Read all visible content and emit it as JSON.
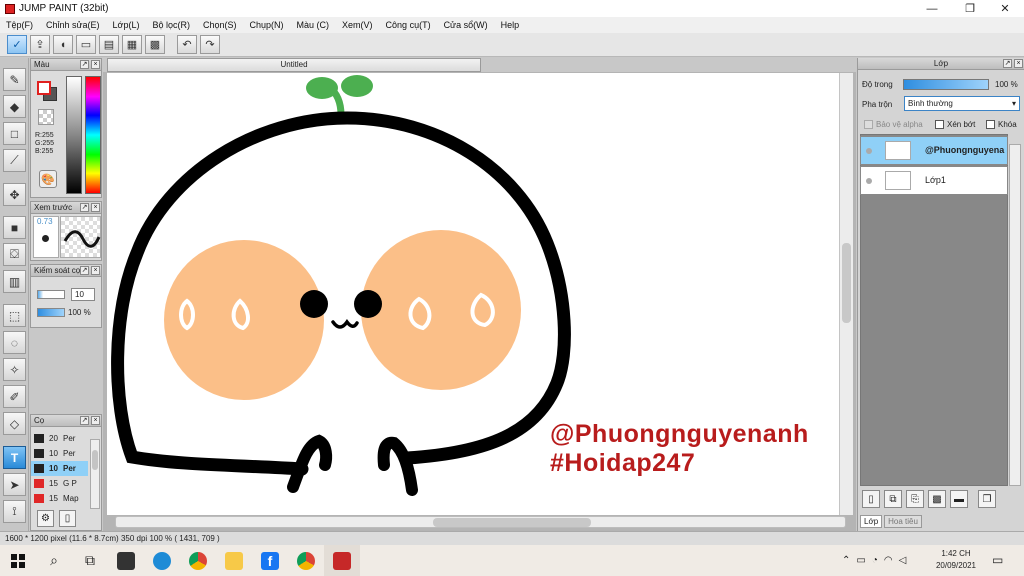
{
  "window": {
    "title": "JUMP PAINT (32bit)",
    "controls": {
      "minimize": "—",
      "maximize": "❐",
      "close": "✕"
    }
  },
  "menu": [
    "Tệp(F)",
    "Chỉnh sửa(E)",
    "Lớp(L)",
    "Bộ lọc(R)",
    "Chọn(S)",
    "Chụp(N)",
    "Màu (C)",
    "Xem(V)",
    "Công cụ(T)",
    "Cửa sổ(W)",
    "Help"
  ],
  "toolbar_icons": [
    "check-icon",
    "export-icon",
    "speech-icon",
    "comment-icon",
    "page-icon",
    "layout-icon",
    "grid-icon",
    "undo-icon",
    "redo-icon"
  ],
  "color_panel": {
    "title": "Màu",
    "rgb": {
      "r": "R:255",
      "g": "G:255",
      "b": "B:255"
    },
    "foreground": "#ffffff",
    "background_swatch": "#e0201f"
  },
  "preview_panel": {
    "title": "Xem trước",
    "size": "0.73"
  },
  "brush_control_panel": {
    "title": "Kiểm soát cọ",
    "size_value": "10",
    "opacity_value": "100 %"
  },
  "brush_list_panel": {
    "title": "Cọ",
    "items": [
      {
        "size": "20",
        "name": "Per",
        "color": "#222222"
      },
      {
        "size": "10",
        "name": "Per",
        "color": "#222222"
      },
      {
        "size": "10",
        "name": "Per",
        "color": "#222222",
        "selected": true
      },
      {
        "size": "15",
        "name": "G P",
        "color": "#e02828"
      },
      {
        "size": "15",
        "name": "Map",
        "color": "#e02828"
      }
    ]
  },
  "document": {
    "tab_title": "Untitled"
  },
  "canvas": {
    "watermark_line1": "@Phuongnguyenanh",
    "watermark_line2": "#Hoidap247",
    "colors": {
      "outline": "#000000",
      "cheek": "#fbbf88",
      "sprout": "#4caf50",
      "watermark": "#b81c1c"
    }
  },
  "status_bar": {
    "size": "1600 * 1200 pixel",
    "physical": "(11.6 * 8.7cm)",
    "dpi": "350 dpi",
    "zoom": "100 %",
    "coords": "( 1431, 709 )"
  },
  "layer_panel": {
    "title": "Lớp",
    "opacity_label": "Độ trong",
    "opacity_value": "100 %",
    "blend_label": "Pha trộn",
    "blend_value": "Bình thường",
    "protect_alpha": "Bảo vệ alpha",
    "clip": "Xén bớt",
    "lock": "Khóa",
    "layers": [
      {
        "name": "@Phuongnguyena",
        "selected": true
      },
      {
        "name": "Lớp1",
        "selected": false
      }
    ],
    "tabs": [
      "Lớp",
      "Hoa tiêu"
    ]
  },
  "taskbar": {
    "time": "1:42 CH",
    "date": "20/09/2021"
  }
}
